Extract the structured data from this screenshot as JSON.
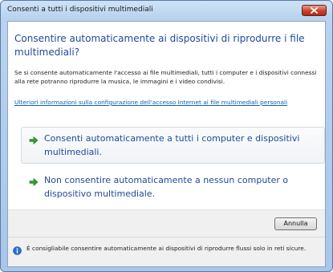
{
  "window": {
    "title": "Consenti a tutti i dispositivi multimediali"
  },
  "content": {
    "heading": "Consentire automaticamente ai dispositivi di riprodurre i file multimediali?",
    "description": "Se si consente automaticamente l'accesso ai file multimediali, tutti i computer e i dispositivi connessi alla rete potranno riprodurre la musica, le immagini e i video condivisi.",
    "link": "Ulteriori informazioni sulla configurazione dell'accesso Internet ai file multimediali personali"
  },
  "options": [
    {
      "label": "Consenti automaticamente a tutti i computer e dispositivi multimediali.",
      "icon": "green-arrow-icon"
    },
    {
      "label": "Non consentire automaticamente a nessun computer o dispositivo multimediale.",
      "icon": "green-arrow-icon"
    }
  ],
  "footer": {
    "cancel_label": "Annulla",
    "info_text": "È consigliabile consentire automaticamente ai dispositivi di riprodurre flussi solo in reti sicure.",
    "info_icon": "info-icon"
  },
  "colors": {
    "heading": "#1f4a9b",
    "link": "#0b5fb8",
    "arrow": "#2f9e2f",
    "close_button": "#c4432b"
  }
}
